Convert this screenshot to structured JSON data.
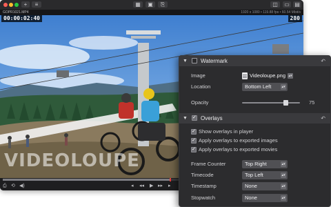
{
  "window": {
    "toolbar_add": "+",
    "toolbar_menu": "≡"
  },
  "file": {
    "name": "GOPR1021.MP4",
    "info": "1920 x 1080 • 119.88 fps • 60.54 Mbit/s"
  },
  "video": {
    "timecode": "00:00:02:40",
    "stopwatch": "280",
    "watermark_text": "VIDEOLOUPE"
  },
  "playback": {
    "progress": 0.56,
    "controls": [
      "◂",
      "◂◂",
      "▶",
      "▸▸",
      "▸"
    ]
  },
  "panel": {
    "watermark": {
      "title": "Watermark",
      "enabled": false,
      "image_label": "Image",
      "image_value": "Videoloupe.png",
      "location_label": "Location",
      "location_value": "Bottom Left",
      "opacity_label": "Opacity",
      "opacity_value": "75",
      "opacity_fraction": 0.75
    },
    "overlays": {
      "title": "Overlays",
      "enabled": true,
      "checkboxes": [
        {
          "label": "Show overlays in player",
          "checked": true
        },
        {
          "label": "Apply overlays to exported images",
          "checked": true
        },
        {
          "label": "Apply overlays to exported movies",
          "checked": true
        }
      ],
      "settings": [
        {
          "label": "Frame Counter",
          "value": "Top Right"
        },
        {
          "label": "Timecode",
          "value": "Top Left"
        },
        {
          "label": "Timestamp",
          "value": "None"
        },
        {
          "label": "Stopwatch",
          "value": "None"
        }
      ]
    },
    "reset_icon": "reset-arrow-icon"
  },
  "colors": {
    "panel_bg": "#2c2c2e",
    "header_bg": "#3a3a3d",
    "control_bg": "#505054",
    "playhead": "#e03a3a"
  }
}
